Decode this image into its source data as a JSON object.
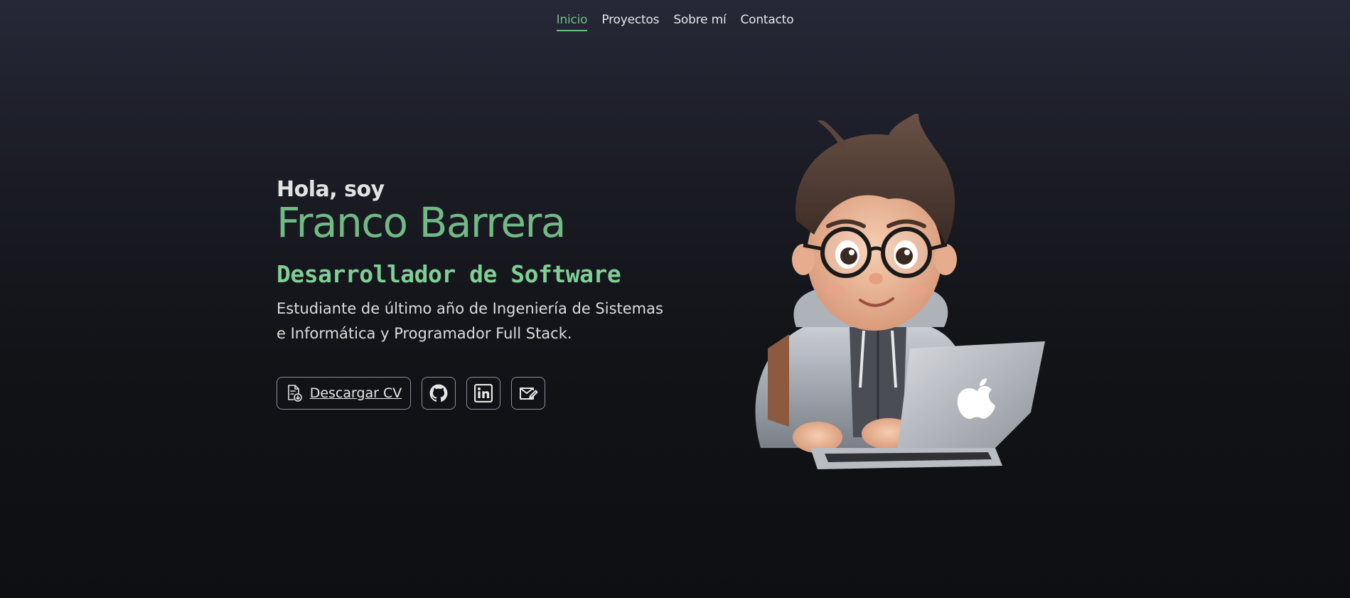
{
  "nav": {
    "items": [
      {
        "label": "Inicio",
        "active": true
      },
      {
        "label": "Proyectos",
        "active": false
      },
      {
        "label": "Sobre mí",
        "active": false
      },
      {
        "label": "Contacto",
        "active": false
      }
    ]
  },
  "hero": {
    "greeting": "Hola, soy",
    "name": "Franco Barrera",
    "role": "Desarrollador de Software",
    "description_line1": "Estudiante de último año de Ingeniería de Sistemas",
    "description_line2": "e Informática y Programador Full Stack.",
    "cv_button_label": "Descargar CV",
    "icons": {
      "cv": "file-download-icon",
      "github": "github-icon",
      "linkedin": "linkedin-icon",
      "email": "mail-edit-icon"
    }
  },
  "avatar": {
    "icon": "avatar-illustration"
  },
  "colors": {
    "accent": "#6fbf86",
    "name": "#72b985",
    "role": "#7fcf95",
    "background_top": "#262837",
    "background_bottom": "#0e0f12"
  }
}
